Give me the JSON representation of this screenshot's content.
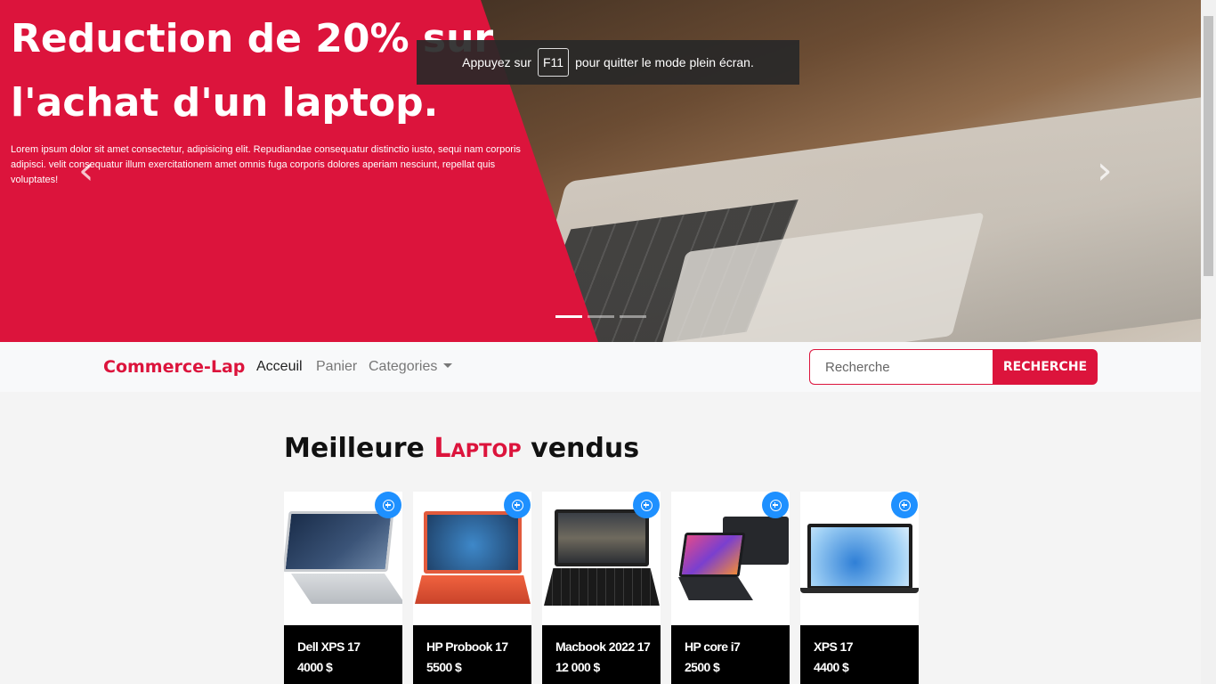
{
  "hero": {
    "title": "Reduction de 20% sur l'achat d'un laptop.",
    "text": "Lorem ipsum dolor sit amet consectetur, adipisicing elit. Repudiandae consequatur distinctio iusto, sequi nam corporis adipisci. velit consequatur illum exercitationem amet omnis fuga corporis dolores aperiam nesciunt, repellat quis voluptates!",
    "prev_icon": "chevron-left-icon",
    "next_icon": "chevron-right-icon",
    "slides": 3,
    "active_slide": 1,
    "accent_color": "#dc143c"
  },
  "fullscreen_notice": {
    "before": "Appuyez sur",
    "key": "F11",
    "after": "pour quitter le mode plein écran."
  },
  "navbar": {
    "brand": "Commerce-Lap",
    "links": [
      {
        "label": "Acceuil",
        "active": true
      },
      {
        "label": "Panier",
        "active": false
      },
      {
        "label": "Categories",
        "active": false,
        "dropdown": true
      }
    ],
    "search": {
      "placeholder": "Recherche",
      "button_label": "RECHERCHE"
    }
  },
  "section": {
    "title_start": "Meilleure",
    "title_accent": "Laptop",
    "title_end": "vendus"
  },
  "products": [
    {
      "name": "Dell XPS 17",
      "price": "4000 $",
      "add_icon": "plus-circle-icon"
    },
    {
      "name": "HP Probook 17",
      "price": "5500 $",
      "add_icon": "plus-circle-icon"
    },
    {
      "name": "Macbook 2022 17",
      "price": "12 000 $",
      "add_icon": "plus-circle-icon"
    },
    {
      "name": "HP core i7",
      "price": "2500 $",
      "add_icon": "plus-circle-icon"
    },
    {
      "name": "XPS 17",
      "price": "4400 $",
      "add_icon": "plus-circle-icon"
    }
  ]
}
